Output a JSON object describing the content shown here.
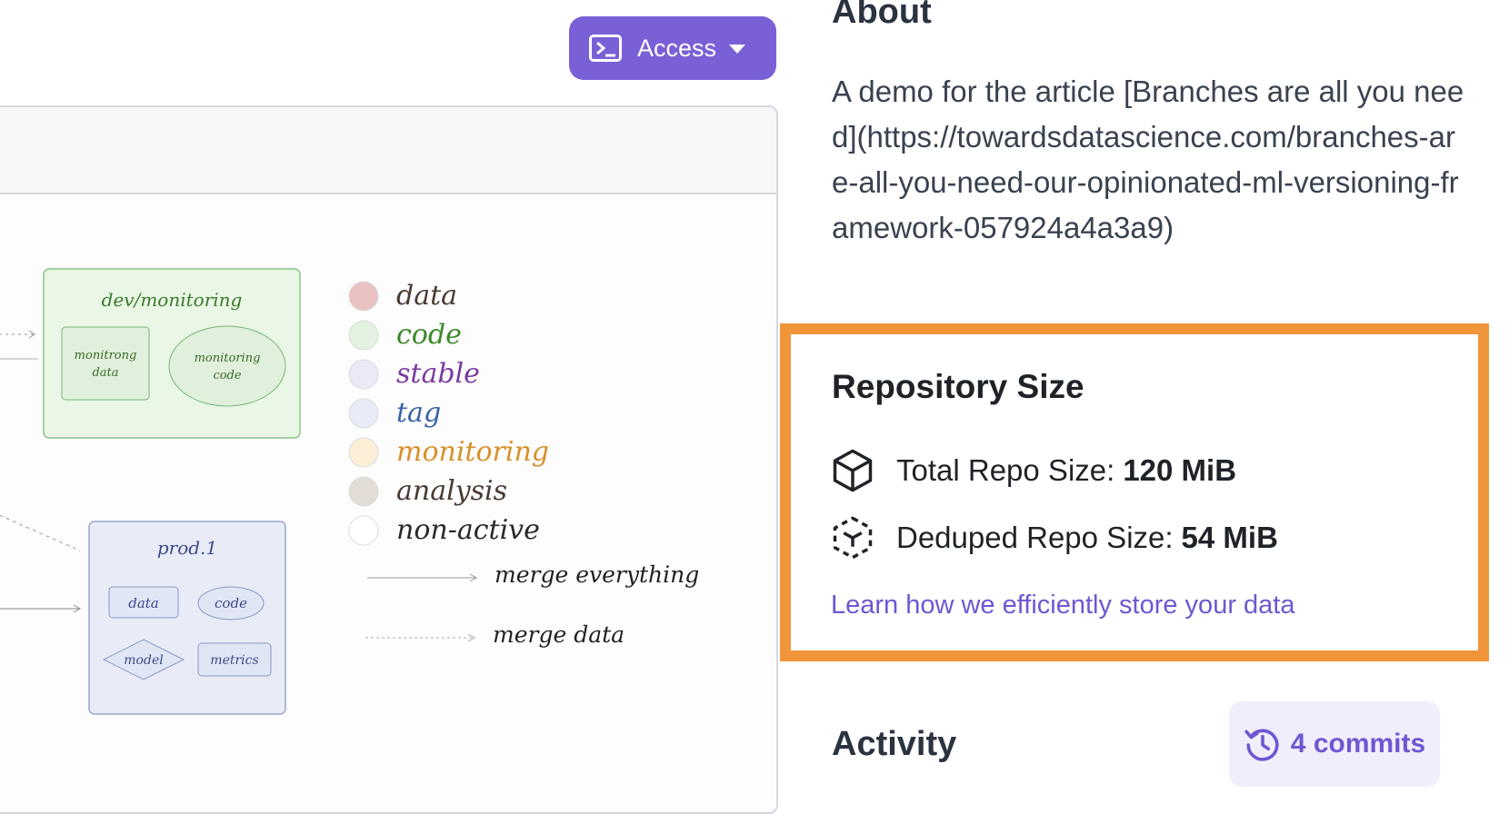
{
  "access_button": {
    "label": "Access"
  },
  "diagram": {
    "dev_box": {
      "title": "dev/monitoring",
      "left_item": [
        "monitrong",
        "data"
      ],
      "right_item": [
        "monitoring",
        "code"
      ]
    },
    "prod_box": {
      "title": "prod.1",
      "items": [
        "data",
        "code",
        "model",
        "metrics"
      ]
    },
    "legend": [
      {
        "label": "data",
        "color": "#4a3a33",
        "dot": "#e9c2c2"
      },
      {
        "label": "code",
        "color": "#3a8a2a",
        "dot": "#e3f2e0"
      },
      {
        "label": "stable",
        "color": "#7a3aa0",
        "dot": "#ece8f6"
      },
      {
        "label": "tag",
        "color": "#3a64a8",
        "dot": "#e8ebf6"
      },
      {
        "label": "monitoring",
        "color": "#d8902a",
        "dot": "#fbefd8"
      },
      {
        "label": "analysis",
        "color": "#4a3a33",
        "dot": "#e3ddd5"
      },
      {
        "label": "non-active",
        "color": "#2a2a2a",
        "dot": "#ffffff"
      }
    ],
    "merge_everything": "merge everything",
    "merge_data": "merge data"
  },
  "about": {
    "title": "About",
    "description": "A demo for the article [Branches are all you need](https://towardsdatascience.com/branches-are-all-you-need-our-opinionated-ml-versioning-framework-057924a4a3a9)"
  },
  "repo_size": {
    "title": "Repository Size",
    "total_label": "Total Repo Size:",
    "total_value": "120 MiB",
    "deduped_label": "Deduped Repo Size:",
    "deduped_value": "54 MiB",
    "link": "Learn how we efficiently store your data",
    "highlight_color": "#f0953a"
  },
  "activity": {
    "title": "Activity",
    "commits": "4 commits"
  },
  "colors": {
    "accent": "#7b5fd6",
    "link": "#6e57d2"
  },
  "icons": [
    "terminal-icon",
    "caret-down-icon",
    "cube-icon",
    "dashed-cube-icon",
    "history-icon"
  ]
}
